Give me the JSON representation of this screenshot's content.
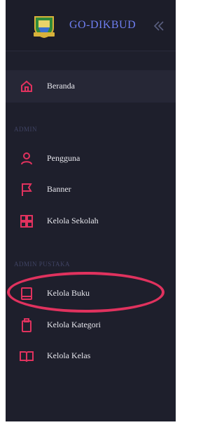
{
  "header": {
    "title": "GO-DIKBUD"
  },
  "menu": {
    "beranda": "Beranda",
    "section_admin": "ADMIN",
    "pengguna": "Pengguna",
    "banner": "Banner",
    "kelola_sekolah": "Kelola Sekolah",
    "section_admin_pustaka": "ADMIN PUSTAKA",
    "kelola_buku": "Kelola Buku",
    "kelola_kategori": "Kelola Kategori",
    "kelola_kelas": "Kelola Kelas"
  },
  "colors": {
    "accent": "#e0325e",
    "title": "#6e7ef0",
    "sidebar_bg": "#1e1f2c"
  },
  "icons": {
    "logo": "crest-logo-icon",
    "collapse": "double-chevron-left-icon",
    "beranda": "home-icon",
    "pengguna": "user-icon",
    "banner": "flag-icon",
    "kelola_sekolah": "grid-icon",
    "kelola_buku": "book-icon",
    "kelola_kategori": "clipboard-icon",
    "kelola_kelas": "open-book-icon"
  }
}
